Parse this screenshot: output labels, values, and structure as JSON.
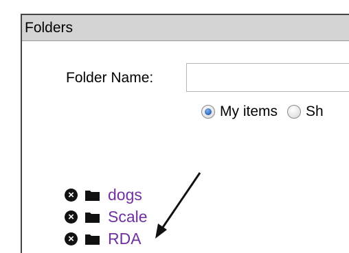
{
  "panel": {
    "title": "Folders"
  },
  "form": {
    "folder_name_label": "Folder Name:",
    "folder_name_value": "",
    "radio_options": [
      {
        "label": "My items",
        "checked": true
      },
      {
        "label": "Sh",
        "checked": false
      }
    ]
  },
  "folders": [
    {
      "name": "dogs",
      "remove_icon": "remove-circle-icon",
      "folder_icon": "folder-icon"
    },
    {
      "name": "Scale",
      "remove_icon": "remove-circle-icon",
      "folder_icon": "folder-icon"
    },
    {
      "name": "RDA",
      "remove_icon": "remove-circle-icon",
      "folder_icon": "folder-icon"
    }
  ],
  "colors": {
    "header_bg": "#d4d4d4",
    "link": "#7030a0",
    "radio_checked": "#2a63b8"
  }
}
